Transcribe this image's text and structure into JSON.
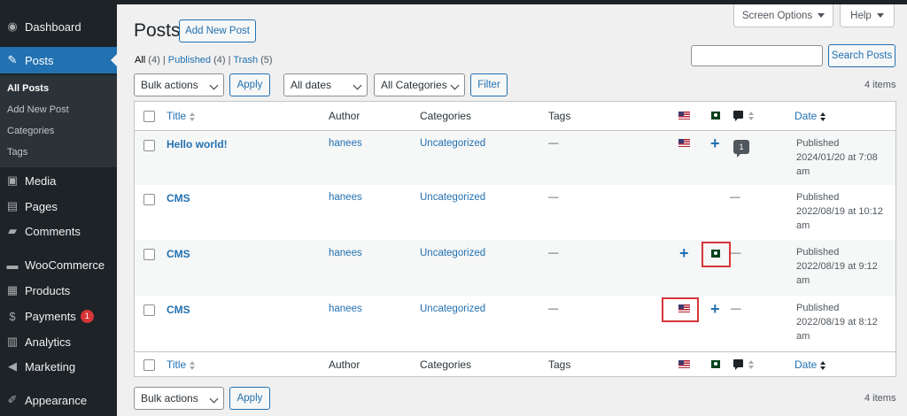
{
  "sidebar": {
    "items": [
      {
        "label": "Dashboard",
        "icon": "dashboard-icon"
      },
      {
        "label": "Posts",
        "icon": "pin-icon"
      },
      {
        "label": "Media",
        "icon": "media-icon"
      },
      {
        "label": "Pages",
        "icon": "pages-icon"
      },
      {
        "label": "Comments",
        "icon": "comments-icon"
      },
      {
        "label": "WooCommerce",
        "icon": "woo-icon"
      },
      {
        "label": "Products",
        "icon": "products-icon"
      },
      {
        "label": "Payments",
        "icon": "payments-icon",
        "badge": "1"
      },
      {
        "label": "Analytics",
        "icon": "analytics-icon"
      },
      {
        "label": "Marketing",
        "icon": "megaphone-icon"
      },
      {
        "label": "Appearance",
        "icon": "brush-icon"
      }
    ],
    "submenu": [
      "All Posts",
      "Add New Post",
      "Categories",
      "Tags"
    ]
  },
  "header": {
    "screen_options": "Screen Options",
    "help": "Help",
    "title": "Posts",
    "add_new": "Add New Post"
  },
  "filters": {
    "all_label": "All",
    "all_count": "(4)",
    "published_label": "Published",
    "published_count": "(4)",
    "trash_label": "Trash",
    "trash_count": "(5)",
    "sep": "|"
  },
  "search": {
    "button": "Search Posts",
    "value": ""
  },
  "tablenav": {
    "bulk_actions": "Bulk actions",
    "apply": "Apply",
    "all_dates": "All dates",
    "all_categories": "All Categories",
    "filter": "Filter",
    "items": "4 items"
  },
  "columns": {
    "title": "Title",
    "author": "Author",
    "categories": "Categories",
    "tags": "Tags",
    "date": "Date"
  },
  "rows": [
    {
      "title": "Hello world!",
      "author": "hanees",
      "category": "Uncategorized",
      "tags": "—",
      "status": "Published",
      "date": "2024/01/20 at 7:08",
      "date2": "am",
      "comments": "1"
    },
    {
      "title": "CMS",
      "author": "hanees",
      "category": "Uncategorized",
      "tags": "—",
      "status": "Published",
      "date": "2022/08/19 at 10:12",
      "date2": "am",
      "comments": "—"
    },
    {
      "title": "CMS",
      "author": "hanees",
      "category": "Uncategorized",
      "tags": "—",
      "status": "Published",
      "date": "2022/08/19 at 9:12",
      "date2": "am",
      "comments": "—"
    },
    {
      "title": "CMS",
      "author": "hanees",
      "category": "Uncategorized",
      "tags": "—",
      "status": "Published",
      "date": "2022/08/19 at 8:12",
      "date2": "am",
      "comments": "—"
    }
  ],
  "icons": {
    "add": "+",
    "sep_dash": "—"
  }
}
